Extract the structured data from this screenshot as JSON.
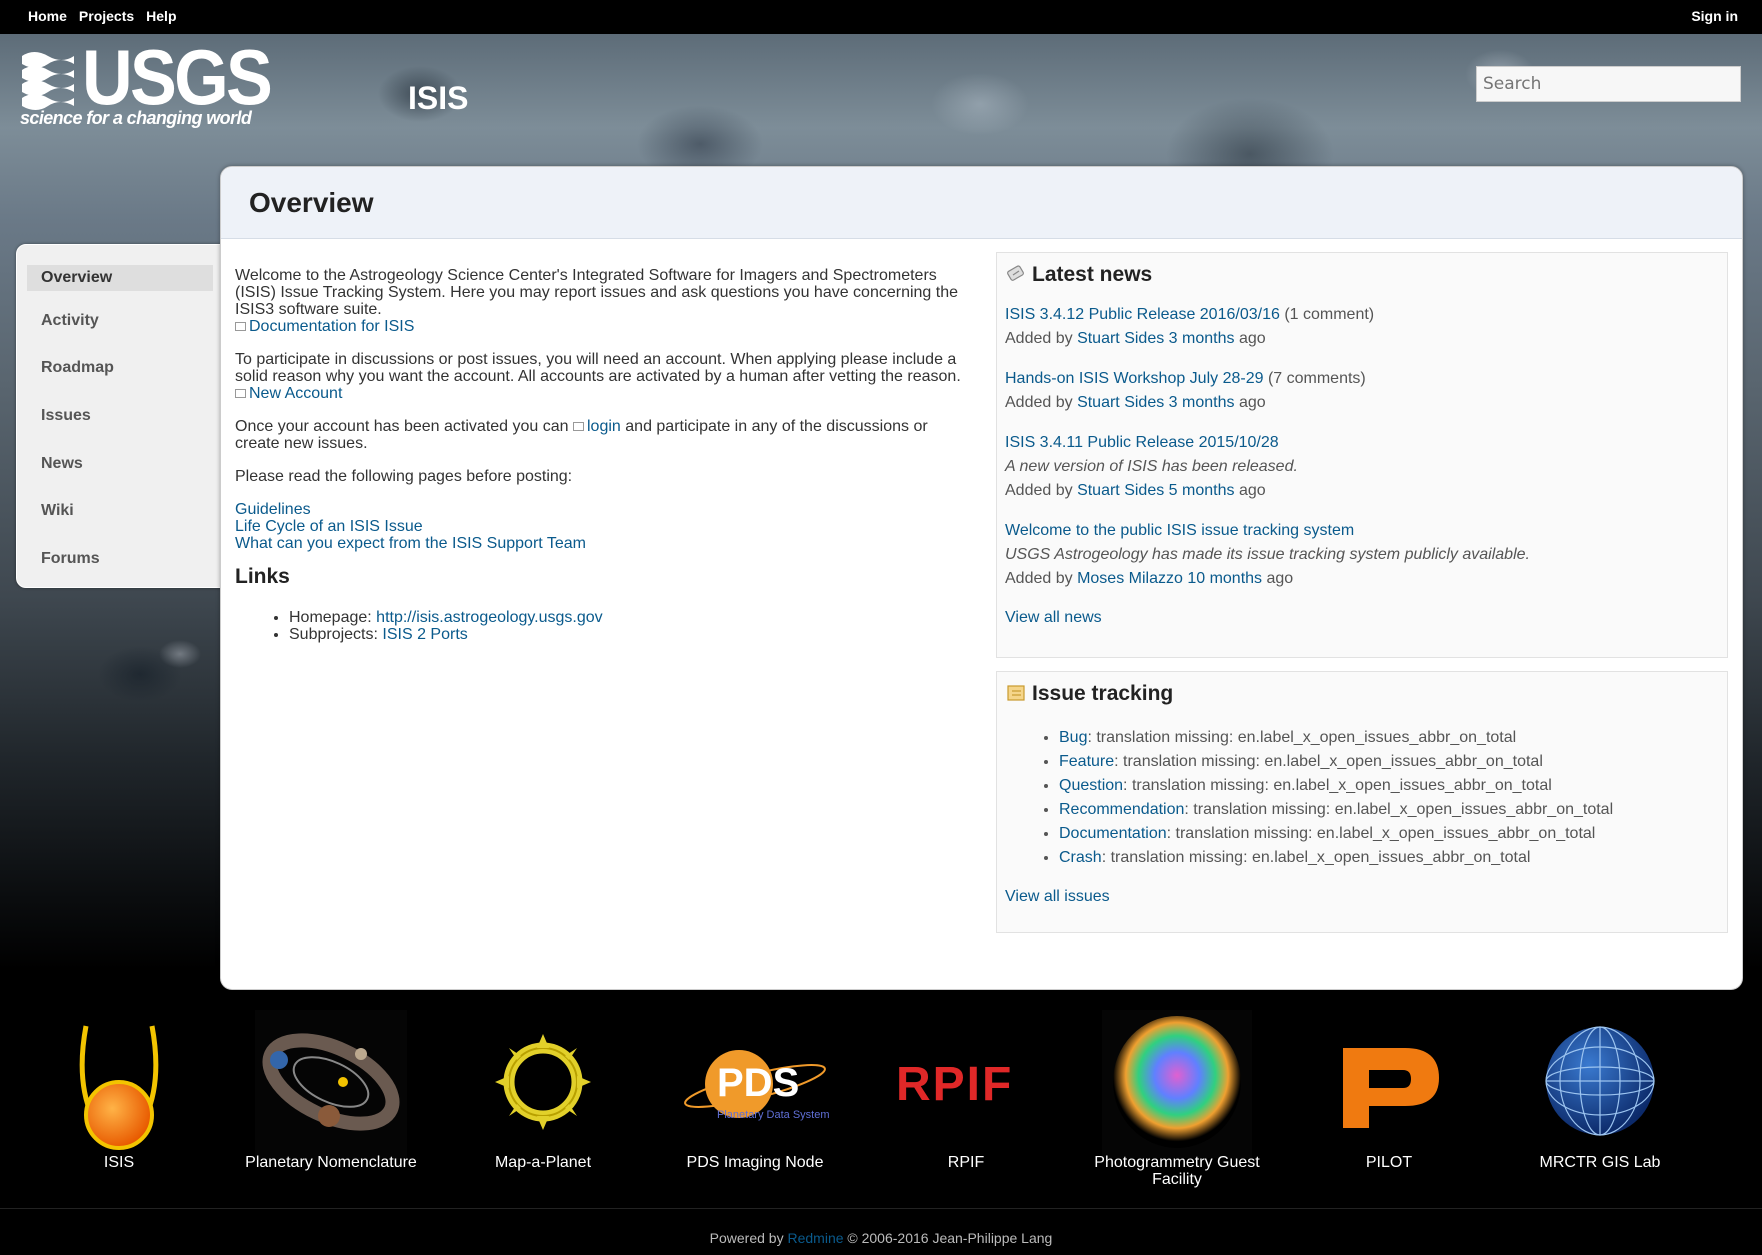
{
  "top_menu": {
    "home": "Home",
    "projects": "Projects",
    "help": "Help",
    "sign_in": "Sign in"
  },
  "header": {
    "logo_text": "USGS",
    "logo_tagline": "science for a changing world",
    "project_title": "ISIS",
    "search_placeholder": "Search"
  },
  "sidebar": {
    "items": [
      {
        "label": "Overview",
        "selected": true
      },
      {
        "label": "Activity"
      },
      {
        "label": "Roadmap"
      },
      {
        "label": "Issues"
      },
      {
        "label": "News"
      },
      {
        "label": "Wiki"
      },
      {
        "label": "Forums"
      }
    ]
  },
  "main": {
    "title": "Overview",
    "intro": "Welcome to the Astrogeology Science Center's Integrated Software for Imagers and Spectrometers (ISIS) Issue Tracking System. Here you may report issues and ask questions you have concerning the ISIS3 software suite.",
    "doc_link": "Documentation for ISIS",
    "account_text": "To participate in discussions or post issues, you will need an account. When applying please include a solid reason why you want the account. All accounts are activated by a human after vetting the reason.",
    "new_account_link": "New Account",
    "login_before": "Once your account has been activated you can",
    "login_link": "login",
    "login_after": "and participate in any of the discussions or create new issues.",
    "read_text": "Please read the following pages before posting:",
    "guide_links": [
      "Guidelines",
      "Life Cycle of an ISIS Issue",
      "What can you expect from the ISIS Support Team"
    ],
    "links_heading": "Links",
    "homepage_label": "Homepage:",
    "homepage_url": "http://isis.astrogeology.usgs.gov",
    "subprojects_label": "Subprojects:",
    "subprojects_value": "ISIS 2 Ports"
  },
  "news": {
    "heading": "Latest news",
    "added_by": "Added by",
    "ago": "ago",
    "items": [
      {
        "title": "ISIS 3.4.12 Public Release 2016/03/16",
        "comments": "(1 comment)",
        "summary": "",
        "author": "Stuart Sides",
        "age": "3 months"
      },
      {
        "title": "Hands-on ISIS Workshop July 28-29",
        "comments": "(7 comments)",
        "summary": "",
        "author": "Stuart Sides",
        "age": "3 months"
      },
      {
        "title": "ISIS 3.4.11 Public Release 2015/10/28",
        "comments": "",
        "summary": "A new version of ISIS has been released.",
        "author": "Stuart Sides",
        "age": "5 months"
      },
      {
        "title": "Welcome to the public ISIS issue tracking system",
        "comments": "",
        "summary": "USGS Astrogeology has made its issue tracking system publicly available.",
        "author": "Moses Milazzo",
        "age": "10 months"
      }
    ],
    "view_all": "View all news"
  },
  "issue_tracking": {
    "heading": "Issue tracking",
    "trackers": [
      {
        "name": "Bug",
        "text": ": translation missing: en.label_x_open_issues_abbr_on_total"
      },
      {
        "name": "Feature",
        "text": ": translation missing: en.label_x_open_issues_abbr_on_total"
      },
      {
        "name": "Question",
        "text": ": translation missing: en.label_x_open_issues_abbr_on_total"
      },
      {
        "name": "Recommendation",
        "text": ": translation missing: en.label_x_open_issues_abbr_on_total"
      },
      {
        "name": "Documentation",
        "text": ": translation missing: en.label_x_open_issues_abbr_on_total"
      },
      {
        "name": "Crash",
        "text": ": translation missing: en.label_x_open_issues_abbr_on_total"
      }
    ],
    "view_all": "View all issues"
  },
  "footer_links": [
    {
      "label": "ISIS",
      "icon": "isis-logo-icon"
    },
    {
      "label": "Planetary Nomenclature",
      "icon": "planetary-nomenclature-icon"
    },
    {
      "label": "Map-a-Planet",
      "icon": "map-a-planet-icon"
    },
    {
      "label": "PDS Imaging Node",
      "icon": "pds-logo-icon"
    },
    {
      "label": "RPIF",
      "icon": "rpif-logo-icon"
    },
    {
      "label": "Photogrammetry Guest Facility",
      "icon": "photogrammetry-icon"
    },
    {
      "label": "PILOT",
      "icon": "pilot-logo-icon"
    },
    {
      "label": "MRCTR GIS Lab",
      "icon": "globe-icon"
    }
  ],
  "footer": {
    "powered_by": "Powered by",
    "redmine": "Redmine",
    "copyright": "© 2006-2016 Jean-Philippe Lang"
  },
  "colors": {
    "link": "#0a5a8c",
    "page_bg": "#000000",
    "card_header": "#eef2f8"
  }
}
